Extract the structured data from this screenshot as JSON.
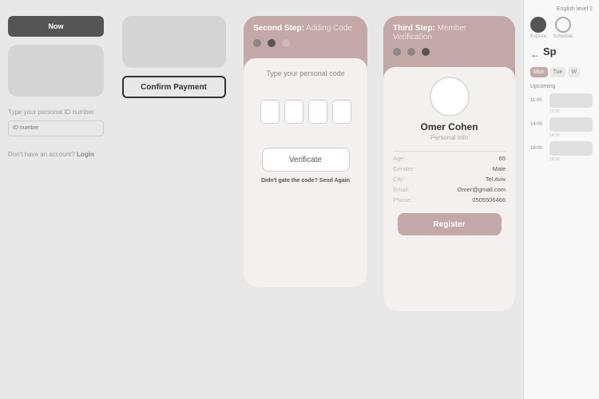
{
  "panel1": {
    "button_label": "Now",
    "label_id": "Type your personal ID number",
    "input_placeholder": "ID number",
    "link_text": "Don't have an account?",
    "link_action": "Login"
  },
  "panel2": {
    "top_card_placeholder": "",
    "confirm_button": "Confirm Payment"
  },
  "panel3": {
    "step_label": "Second Step:",
    "step_detail": "Adding Code",
    "prompt": "Type your personal code",
    "verificate_button": "Verificate",
    "resend_prefix": "Didn't gate the code?",
    "resend_action": "Send Again"
  },
  "panel4": {
    "step_label": "Third Step:",
    "step_detail": "Member Verification",
    "user_name": "Omer Cohen",
    "personal_info_label": "Personal Info",
    "fields": [
      {
        "key": "Age:",
        "value": "65"
      },
      {
        "key": "Gender:",
        "value": "Male"
      },
      {
        "key": "City:",
        "value": "Tel Aviv"
      },
      {
        "key": "Email:",
        "value": "Omer@gmail.com"
      },
      {
        "key": "Phone:",
        "value": "0505506466"
      }
    ],
    "register_button": "Register"
  },
  "sidebar": {
    "lang": "English level 2",
    "back_arrow": "←",
    "title": "Sp",
    "days": [
      "Mon",
      "Tue",
      "W"
    ],
    "upcoming_label": "Upcoming",
    "explore_label": "Explore",
    "schedule_label": "Schedule",
    "time_slots": [
      {
        "start": "11:00",
        "end": "12:30"
      },
      {
        "start": "14:00",
        "end": "14:50"
      },
      {
        "start": "18:00",
        "end": "18:50"
      }
    ]
  }
}
